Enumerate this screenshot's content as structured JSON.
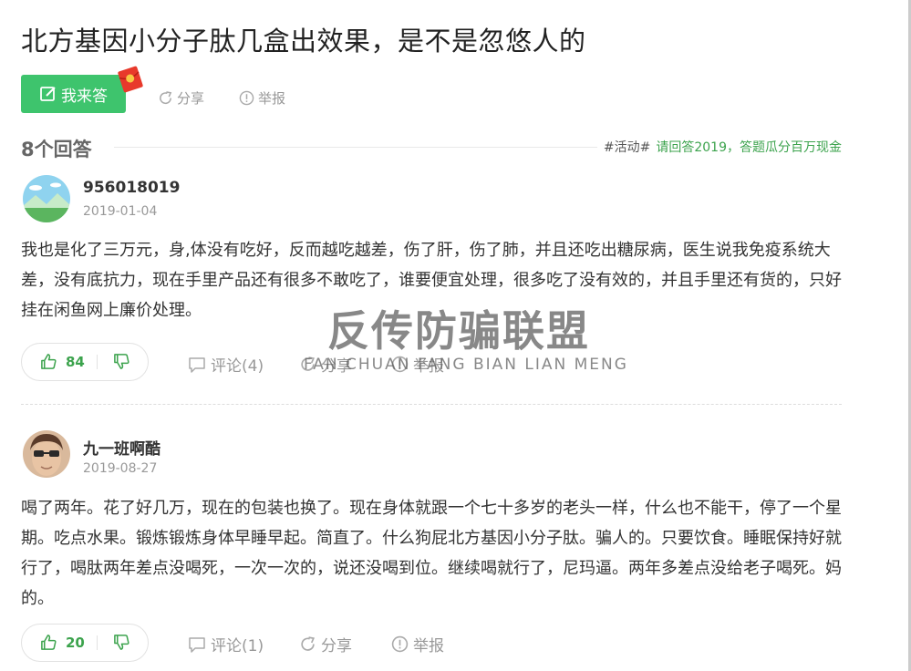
{
  "question": {
    "title": "北方基因小分子肽几盒出效果，是不是忽悠人的",
    "answer_button": "我来答",
    "share": "分享",
    "report": "举报"
  },
  "answers_header": {
    "count": "8个回答",
    "activity_tag": "#活动#",
    "activity_link": "请回答2019，答题瓜分百万现金"
  },
  "answers": [
    {
      "username": "956018019",
      "date": "2019-01-04",
      "content": "我也是化了三万元，身,体没有吃好，反而越吃越差，伤了肝，伤了肺，并且还吃出糖尿病，医生说我免疫系统大差，没有底抗力，现在手里产品还有很多不敢吃了，谁要便宜处理，很多吃了没有效的，并且手里还有货的，只好挂在闲鱼网上廉价处理。",
      "likes": "84",
      "comment": "评论(4)",
      "share": "分享",
      "report": "举报"
    },
    {
      "username": "九一班啊酷",
      "date": "2019-08-27",
      "content": "喝了两年。花了好几万，现在的包装也换了。现在身体就跟一个七十多岁的老头一样，什么也不能干，停了一个星期。吃点水果。锻炼锻炼身体早睡早起。简直了。什么狗屁北方基因小分子肽。骗人的。只要饮食。睡眠保持好就行了，喝肽两年差点没喝死，一次一次的，说还没喝到位。继续喝就行了，尼玛逼。两年多差点没给老子喝死。妈的。",
      "likes": "20",
      "comment": "评论(1)",
      "share": "分享",
      "report": "举报"
    }
  ],
  "watermark": {
    "main": "反传防骗联盟",
    "sub": "FAN CHUAN FANG BIAN LIAN MENG"
  },
  "colors": {
    "accent_green": "#3ec46d",
    "link_green": "#3ca34d",
    "muted": "#999999"
  }
}
